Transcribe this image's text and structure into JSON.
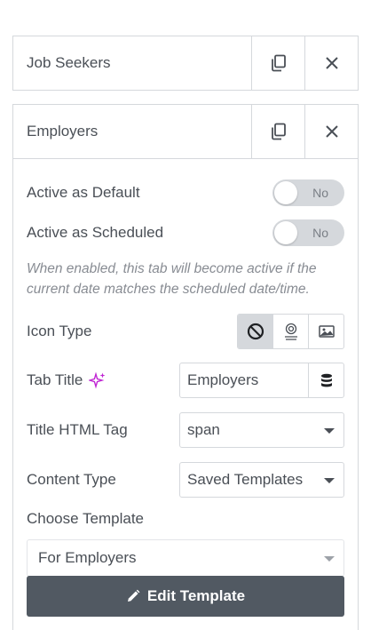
{
  "rows": [
    {
      "title": "Job Seekers"
    },
    {
      "title": "Employers"
    }
  ],
  "fields": {
    "active_default": {
      "label": "Active as Default",
      "value": "No"
    },
    "active_scheduled": {
      "label": "Active as Scheduled",
      "value": "No"
    },
    "scheduled_desc": "When enabled, this tab will become active if the current date matches the scheduled date/time.",
    "icon_type": {
      "label": "Icon Type",
      "options": [
        "none-icon",
        "icon-library-icon",
        "image-icon"
      ],
      "selected": "none-icon"
    },
    "tab_title": {
      "label": "Tab Title",
      "value": "Employers"
    },
    "title_tag": {
      "label": "Title HTML Tag",
      "value": "span"
    },
    "content_type": {
      "label": "Content Type",
      "value": "Saved Templates"
    },
    "choose_template": {
      "label": "Choose Template",
      "value": "For Employers"
    },
    "edit_template": {
      "label": "Edit Template"
    }
  },
  "colors": {
    "ai_sparkle": "#c026d3",
    "button_bg": "#515962",
    "switch_bg": "#d5d8dc"
  }
}
